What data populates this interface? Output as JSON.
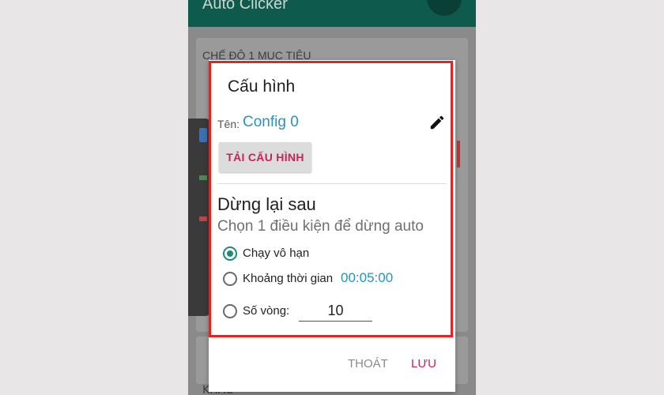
{
  "app": {
    "title": "Auto Clicker"
  },
  "background": {
    "card_title": "CHẾ ĐỘ 1 MỤC TIÊU",
    "card2_title": "KHÁC"
  },
  "dialog": {
    "title": "Cấu hình",
    "name_label": "Tên:",
    "name_value": "Config 0",
    "load_button": "TẢI CẤU HÌNH",
    "stop_section": {
      "title": "Dừng lại sau",
      "subtitle": "Chọn 1 điều kiện để dừng auto",
      "options": [
        {
          "label": "Chạy vô hạn",
          "checked": true
        },
        {
          "label": "Khoảng thời gian",
          "checked": false,
          "value": "00:05:00"
        },
        {
          "label": "Số vòng:",
          "checked": false,
          "value": "10"
        }
      ]
    },
    "actions": {
      "exit": "THOÁT",
      "save": "LƯU"
    }
  },
  "colors": {
    "accent": "#1e8b7a",
    "link": "#2a93b8",
    "button_text": "#c5245a",
    "highlight": "#d62a2a",
    "appbar": "#0e5a4c"
  },
  "icons": {
    "edit": "pencil-icon"
  }
}
